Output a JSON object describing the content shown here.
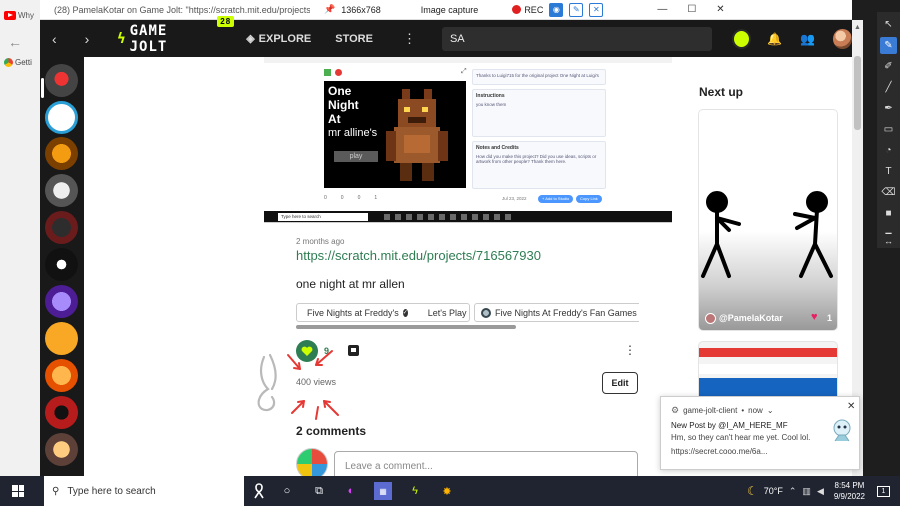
{
  "browser_strip": {
    "tab_text": "Why",
    "bookmark_text": "Getti"
  },
  "window": {
    "title": "(28) PamelaKotar on Game Jolt: \"https://scratch.mit.edu/projects/716...",
    "resolution": "1366x768",
    "capture_label": "Image capture",
    "rec_label": "REC",
    "controls": [
      "—",
      "☐",
      "✕"
    ]
  },
  "gamejolt": {
    "logo": "GAME JOLT",
    "notif_badge": "28",
    "explore": "EXPLORE",
    "store": "STORE",
    "search_value": "SA"
  },
  "post": {
    "screenshot": {
      "title_lines": [
        "One",
        "Night",
        "At"
      ],
      "title_sub": "mr alline's",
      "play": "play",
      "thanks_text": "Thanks to Luigi715 for the original project One Night at Luigi's",
      "instructions_title": "Instructions",
      "instructions_text": "you know them",
      "notes_title": "Notes and Credits",
      "notes_text": "How did you make this project? Did you use ideas, scripts or artwork from other people? Thank them here.",
      "stats": [
        "0",
        "0",
        "0",
        "1"
      ],
      "date": "Jul 23, 2022",
      "add_studio": "+ Add to Studio",
      "copy_link": "Copy Link",
      "search_placeholder": "Type here to search"
    },
    "time_ago": "2 months ago",
    "link": "https://scratch.mit.edu/projects/716567930",
    "text": "one night at mr allen",
    "tags": [
      "Five Nights at Freddy's",
      "Let's Play",
      "Five Nights At Freddy's Fan Games"
    ],
    "likes": "9",
    "views": "400 views",
    "edit": "Edit",
    "comments_title": "2 comments",
    "comment_placeholder": "Leave a comment..."
  },
  "sidebar": {
    "next_up": "Next up",
    "card_user": "@PamelaKotar",
    "card_likes": "1"
  },
  "notification": {
    "app": "game-jolt-client",
    "time": "now",
    "title": "New Post by @I_AM_HERE_MF",
    "body": "Hm, so they can't hear me yet. Cool lol.",
    "link": "https://secret.cooo.me/6a..."
  },
  "taskbar": {
    "search_placeholder": "Type here to search",
    "weather": "70°F",
    "time": "8:54 PM",
    "date": "9/9/2022",
    "notif_count": "1"
  },
  "colors": {
    "gj_bar": "#191919",
    "gj_accent": "#ccff00",
    "link_green": "#2e7d52",
    "taskbar": "#1f2430"
  }
}
